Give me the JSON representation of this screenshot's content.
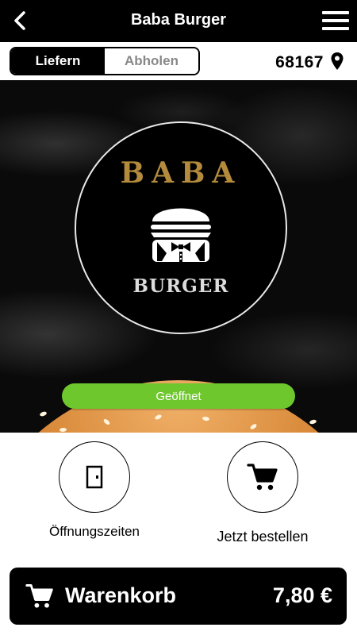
{
  "header": {
    "title": "Baba Burger",
    "back_icon": "chevron-left-icon",
    "menu_icon": "hamburger-menu-icon"
  },
  "mode": {
    "options": [
      "Liefern",
      "Abholen"
    ],
    "selected": "Liefern"
  },
  "location": {
    "zip": "68167",
    "icon": "map-pin-icon"
  },
  "hero": {
    "logo_top": "BABA",
    "logo_bottom": "BURGER",
    "status": "Geöffnet",
    "colors": {
      "logo_gold": "#b48a3c",
      "status_green": "#6fc72e"
    }
  },
  "actions": [
    {
      "label": "Öffnungszeiten",
      "icon": "door-icon"
    },
    {
      "label": "Jetzt bestellen",
      "icon": "shopping-cart-icon"
    }
  ],
  "cart": {
    "label": "Warenkorb",
    "total": "7,80 €",
    "icon": "shopping-cart-icon"
  }
}
